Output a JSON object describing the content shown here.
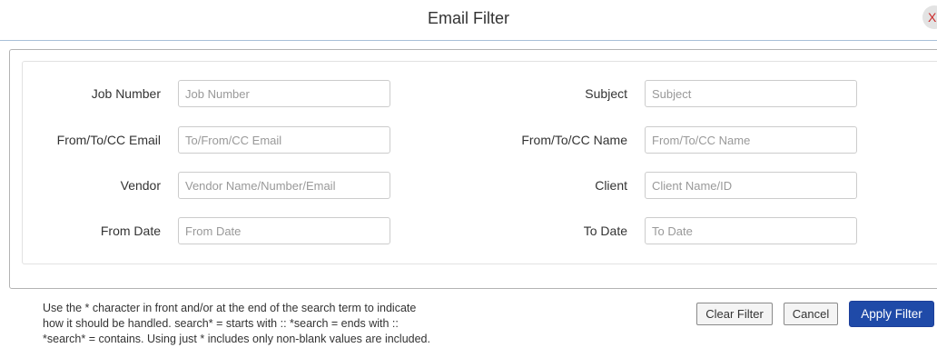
{
  "dialog": {
    "title": "Email Filter",
    "close_label": "X"
  },
  "fields": {
    "job_number": {
      "label": "Job Number",
      "placeholder": "Job Number",
      "value": ""
    },
    "subject": {
      "label": "Subject",
      "placeholder": "Subject",
      "value": ""
    },
    "from_to_cc_email": {
      "label": "From/To/CC Email",
      "placeholder": "To/From/CC Email",
      "value": ""
    },
    "from_to_cc_name": {
      "label": "From/To/CC Name",
      "placeholder": "From/To/CC Name",
      "value": ""
    },
    "vendor": {
      "label": "Vendor",
      "placeholder": "Vendor Name/Number/Email",
      "value": ""
    },
    "client": {
      "label": "Client",
      "placeholder": "Client Name/ID",
      "value": ""
    },
    "from_date": {
      "label": "From Date",
      "placeholder": "From Date",
      "value": ""
    },
    "to_date": {
      "label": "To Date",
      "placeholder": "To Date",
      "value": ""
    }
  },
  "help": {
    "line1": "Use the * character in front and/or at the end of the search term to indicate",
    "line2": "how it should be handled. search* = starts with :: *search = ends with ::",
    "line3": "*search* = contains. Using just * includes only non-blank values are included."
  },
  "buttons": {
    "clear_filter": "Clear Filter",
    "cancel": "Cancel",
    "apply_filter": "Apply Filter"
  },
  "colors": {
    "primary": "#1f4aa8",
    "close_x": "#cc2a2a",
    "divider": "#a9c0d8"
  }
}
